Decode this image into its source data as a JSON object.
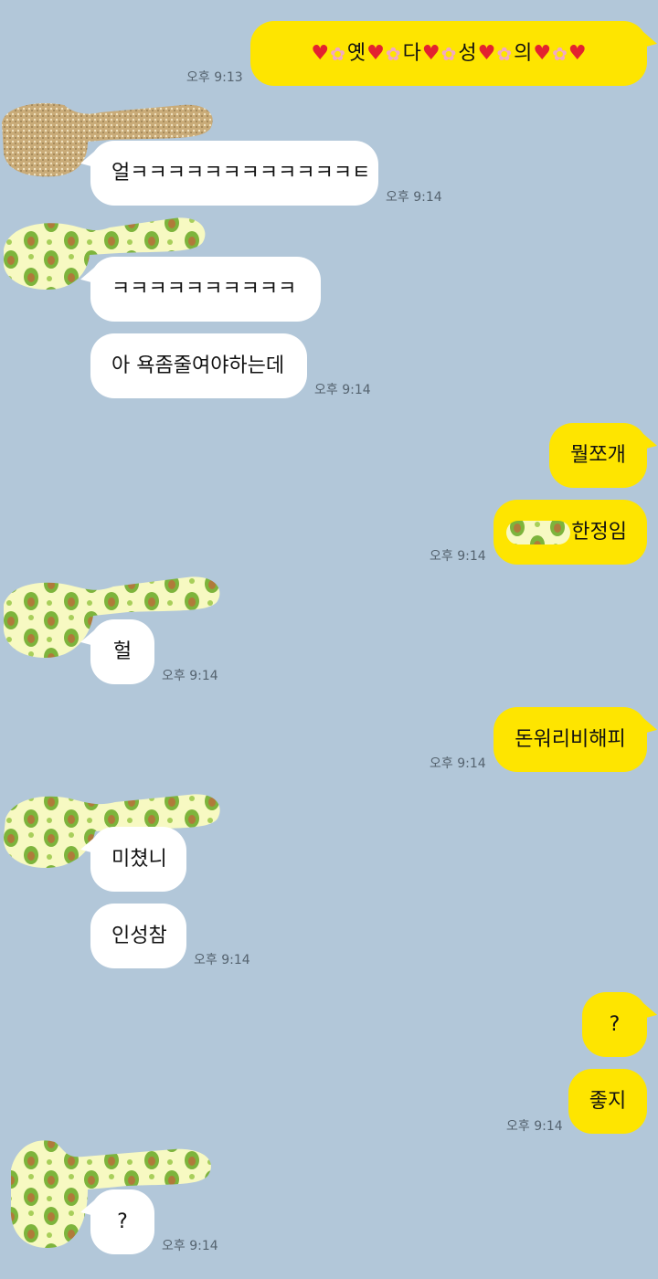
{
  "chat": {
    "messages": [
      {
        "side": "out",
        "parts": [
          "옛",
          "다",
          "성",
          "의"
        ],
        "time": "오후 9:13"
      },
      {
        "side": "in",
        "text": "얼ㅋㅋㅋㅋㅋㅋㅋㅋㅋㅋㅋㅋㅌ",
        "time": "오후 9:14"
      },
      {
        "side": "in",
        "text": "ㅋㅋㅋㅋㅋㅋㅋㅋㅋㅋ"
      },
      {
        "side": "in",
        "text": "아 욕좀줄여야하는데",
        "time": "오후 9:14"
      },
      {
        "side": "out",
        "text": "뭘쪼개"
      },
      {
        "side": "out",
        "text": "한정임",
        "time": "오후 9:14"
      },
      {
        "side": "in",
        "text": "헐",
        "time": "오후 9:14"
      },
      {
        "side": "out",
        "text": "돈워리비해피",
        "time": "오후 9:14"
      },
      {
        "side": "in",
        "text": "미쳤니"
      },
      {
        "side": "in",
        "text": "인성참",
        "time": "오후 9:14"
      },
      {
        "side": "out",
        "text": "?"
      },
      {
        "side": "out",
        "text": "좋지",
        "time": "오후 9:14"
      },
      {
        "side": "in",
        "text": "?",
        "time": "오후 9:14"
      }
    ]
  },
  "icons": {
    "heart": "heart-icon",
    "flower": "cherry-blossom-icon"
  },
  "colors": {
    "background": "#b2c7d9",
    "outgoing_bubble": "#fee500",
    "incoming_bubble": "#ffffff",
    "timestamp": "#55636f",
    "heart": "#e3222f",
    "flower": "#f2a9c4",
    "avatar_sticker_base": "#f7f9c2",
    "avatar_sticker_green": "#7db43c",
    "avatar_sticker_pit": "#b07a3a",
    "avatar_glitter": "#c9ab78"
  }
}
